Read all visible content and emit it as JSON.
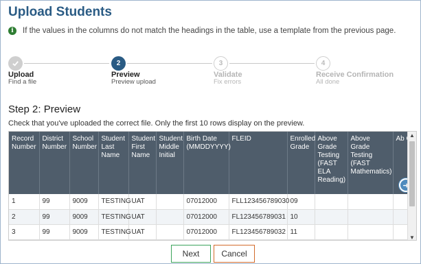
{
  "page": {
    "title": "Upload Students",
    "info_text": "If the values in the columns do not match the headings in the table, use a template from the previous page."
  },
  "stepper": {
    "steps": [
      {
        "number": "",
        "label": "Upload",
        "sub": "Find a file",
        "state": "done"
      },
      {
        "number": "2",
        "label": "Preview",
        "sub": "Preview upload",
        "state": "active"
      },
      {
        "number": "3",
        "label": "Validate",
        "sub": "Fix errors",
        "state": "pending"
      },
      {
        "number": "4",
        "label": "Receive Confirmation",
        "sub": "All done",
        "state": "pending"
      }
    ]
  },
  "section": {
    "heading": "Step 2: Preview",
    "description": "Check that you've uploaded the correct file. Only the first 10 rows display on the preview."
  },
  "table": {
    "headers": [
      "Record Number",
      "District Number",
      "School Number",
      "Student Last Name",
      "Student First Name",
      "Student Middle Initial",
      "Birth Date (MMDDYYYY)",
      "FLEID",
      "Enrolled Grade",
      "Above Grade Testing (FAST ELA Reading)",
      "Above Grade Testing (FAST Mathematics)",
      "Ab Gr Te (B. Wr"
    ],
    "rows": [
      [
        "1",
        "99",
        "9009",
        "TESTING",
        "UAT",
        "",
        "07012000",
        "FLL123456789030",
        "09",
        "",
        "",
        ""
      ],
      [
        "2",
        "99",
        "9009",
        "TESTING",
        "UAT",
        "",
        "07012000",
        "FL123456789031",
        "10",
        "",
        "",
        ""
      ],
      [
        "3",
        "99",
        "9009",
        "TESTING",
        "UAT",
        "",
        "07012000",
        "FL123456789032",
        "11",
        "",
        "",
        ""
      ]
    ]
  },
  "buttons": {
    "next": "Next",
    "cancel": "Cancel"
  },
  "icons": {
    "info": "info-icon",
    "check": "checkmark-icon",
    "scroll_right": "arrow-right-circle-icon"
  },
  "colors": {
    "title": "#2a5b84",
    "active_step": "#2a5b84",
    "table_header": "#4f5d6b",
    "next_border": "#3aa35a",
    "cancel_border": "#d26a2a"
  }
}
